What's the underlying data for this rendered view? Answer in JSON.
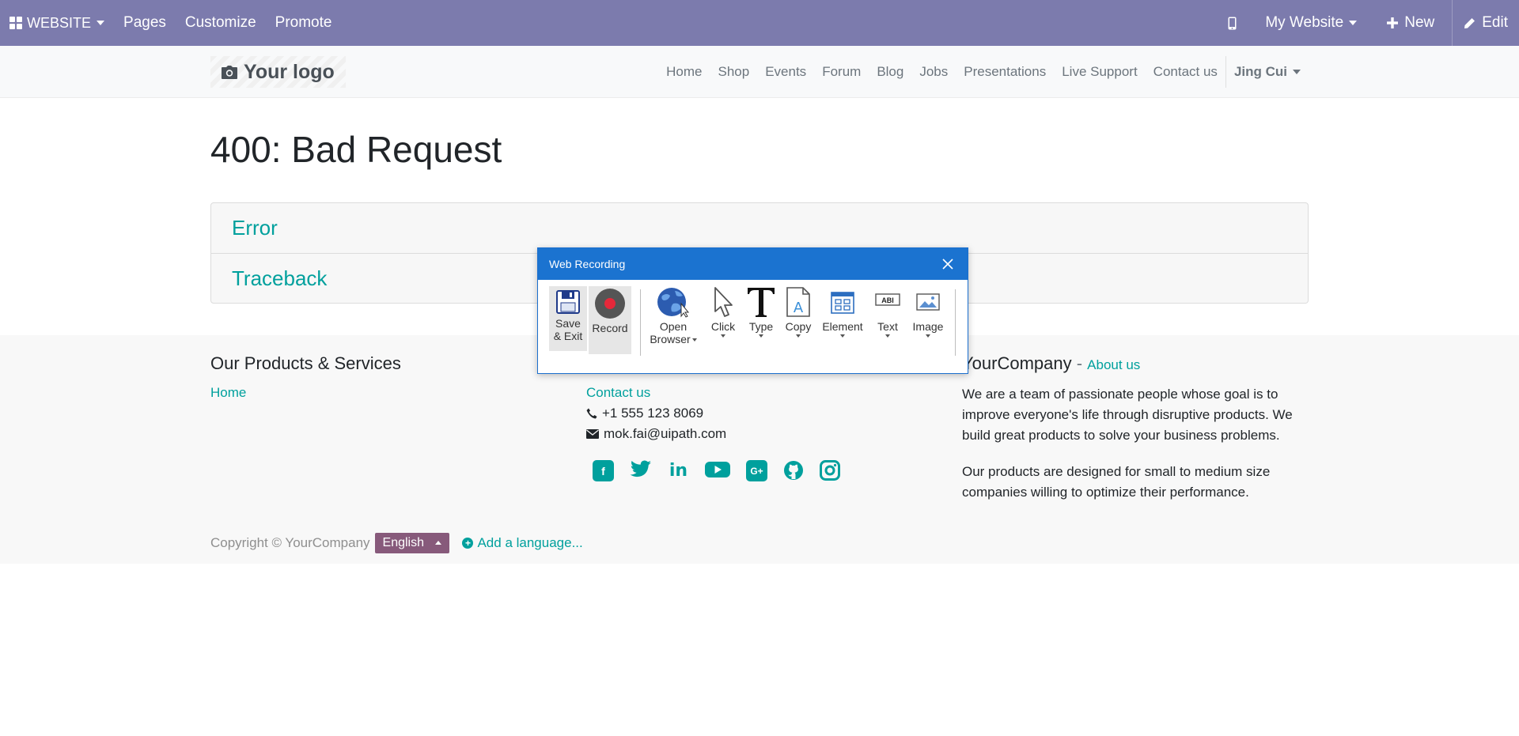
{
  "adminbar": {
    "brand_label": "WEBSITE",
    "menu": [
      "Pages",
      "Customize",
      "Promote"
    ],
    "website_selector": "My Website",
    "new_label": "New",
    "edit_label": "Edit",
    "icons": [
      "apps-grid-icon",
      "mobile-preview-icon",
      "plus-icon",
      "pencil-icon"
    ]
  },
  "header": {
    "logo_text": "Your logo",
    "nav": [
      "Home",
      "Shop",
      "Events",
      "Forum",
      "Blog",
      "Jobs",
      "Presentations",
      "Live Support",
      "Contact us"
    ],
    "user": "Jing Cui"
  },
  "main": {
    "title": "400: Bad Request",
    "panels": [
      "Error",
      "Traceback"
    ]
  },
  "footer": {
    "col1": {
      "heading": "Our Products & Services",
      "links": [
        "Home"
      ]
    },
    "col2": {
      "link": "Contact us",
      "phone": "+1 555 123 8069",
      "email": "mok.fai@uipath.com",
      "social": [
        "facebook-icon",
        "twitter-icon",
        "linkedin-icon",
        "youtube-icon",
        "google-plus-icon",
        "github-icon",
        "instagram-icon"
      ]
    },
    "col3": {
      "heading": "YourCompany",
      "heading_sep": " - ",
      "about_link": "About us",
      "p1": "We are a team of passionate people whose goal is to improve everyone's life through disruptive products. We build great products to solve your business problems.",
      "p2": "Our products are designed for small to medium size companies willing to optimize their performance."
    },
    "copyright": "Copyright © YourCompany",
    "language": "English",
    "add_language": "Add a language..."
  },
  "recorder": {
    "title": "Web Recording",
    "save_label_1": "Save",
    "save_label_2": "& Exit",
    "record_label": "Record",
    "open_label_1": "Open",
    "open_label_2": "Browser",
    "click_label": "Click",
    "type_label": "Type",
    "copy_label": "Copy",
    "element_label": "Element",
    "text_label": "Text",
    "image_label": "Image",
    "text_icon_caption": "ABI",
    "colors": {
      "titlebar": "#1b73d0",
      "record": "#e6283a"
    }
  },
  "colors": {
    "adminbar": "#7c7bad",
    "accent": "#00a09d",
    "language_button": "#875a7b"
  }
}
